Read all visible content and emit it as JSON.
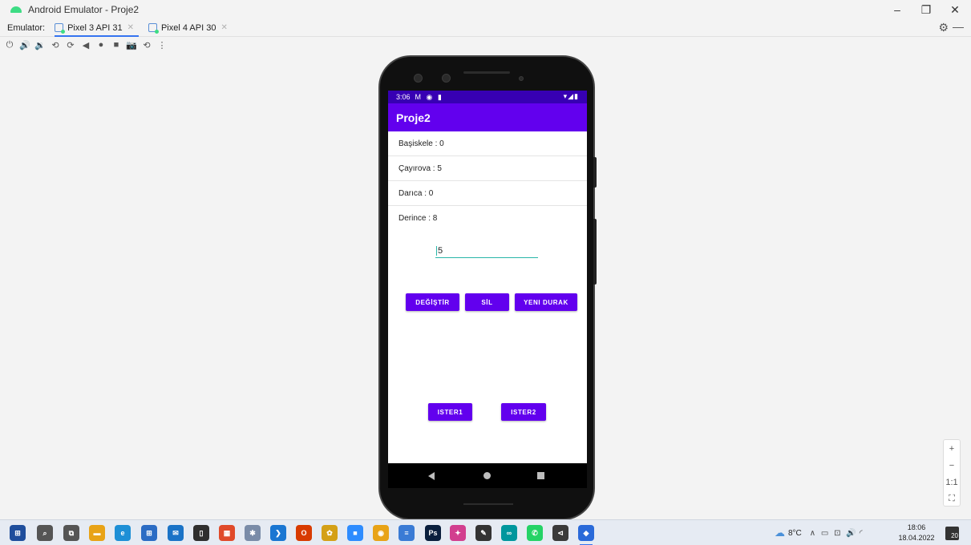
{
  "window": {
    "title": "Android Emulator - Proje2",
    "minimize": "–",
    "maximize": "❐",
    "close": "✕"
  },
  "tabs": {
    "label": "Emulator:",
    "items": [
      {
        "label": "Pixel 3 API 31",
        "active": true
      },
      {
        "label": "Pixel 4 API 30",
        "active": false
      }
    ],
    "close_glyph": "✕",
    "settings_glyph": "⚙",
    "minimize_glyph": "—"
  },
  "toolbar": {
    "icons": [
      "power-icon",
      "volume-up-icon",
      "volume-down-icon",
      "rotate-left-icon",
      "rotate-right-icon",
      "back-icon",
      "home-icon",
      "overview-icon",
      "screenshot-icon",
      "snapshot-icon",
      "more-icon"
    ],
    "glyphs": [
      "⏻",
      "🔊",
      "🔉",
      "⟲",
      "⟳",
      "◀",
      "●",
      "■",
      "📷",
      "⟲",
      "⋮"
    ]
  },
  "device": {
    "status_time": "3:06",
    "status_icons": "M ◉ ▮",
    "status_right": "▾◢▮",
    "app_title": "Proje2",
    "list": [
      "Başiskele : 0",
      "Çayırova : 5",
      "Darıca : 0",
      "Derince : 8"
    ],
    "edit_value": "5",
    "buttons": {
      "degistir": "DEĞİŞTİR",
      "sil": "SİL",
      "yeni_durak": "YENI DURAK",
      "ister1": "ISTER1",
      "ister2": "ISTER2"
    }
  },
  "zoom": {
    "zoom_in": "+",
    "zoom_out": "−",
    "actual": "1:1",
    "fit": "⛶"
  },
  "taskbar": {
    "weather": "8°C",
    "tray_glyphs": "∧ ▭ ⊡ 🔊 ",
    "time": "18:06",
    "date": "18.04.2022",
    "notifications": "20",
    "apps": [
      {
        "name": "start-icon",
        "glyph": "⊞",
        "color": "#1f4e9c"
      },
      {
        "name": "search-icon",
        "glyph": "⌕",
        "color": "#555555"
      },
      {
        "name": "task-view-icon",
        "glyph": "⧉",
        "color": "#555555"
      },
      {
        "name": "file-explorer-icon",
        "glyph": "▬",
        "color": "#e8a317"
      },
      {
        "name": "edge-icon",
        "glyph": "e",
        "color": "#1d8fd6"
      },
      {
        "name": "store-icon",
        "glyph": "⊞",
        "color": "#2b6cc4"
      },
      {
        "name": "mail-icon",
        "glyph": "✉",
        "color": "#1a73c7"
      },
      {
        "name": "notepad-icon",
        "glyph": "▯",
        "color": "#2f2f2f"
      },
      {
        "name": "ms-apps-icon",
        "glyph": "▦",
        "color": "#e04a2a"
      },
      {
        "name": "unity-icon",
        "glyph": "✱",
        "color": "#7a8ca8"
      },
      {
        "name": "vscode-icon",
        "glyph": "❯",
        "color": "#1976d2"
      },
      {
        "name": "office-icon",
        "glyph": "O",
        "color": "#d83b01"
      },
      {
        "name": "paint-icon",
        "glyph": "✿",
        "color": "#d4a017"
      },
      {
        "name": "zoom-icon",
        "glyph": "■",
        "color": "#2d8cff"
      },
      {
        "name": "chrome-icon",
        "glyph": "◉",
        "color": "#e8a317"
      },
      {
        "name": "sublime-icon",
        "glyph": "≡",
        "color": "#3a7bd5"
      },
      {
        "name": "photoshop-icon",
        "glyph": "Ps",
        "color": "#0a1f3d"
      },
      {
        "name": "brain-app-icon",
        "glyph": "✦",
        "color": "#d23f8f"
      },
      {
        "name": "pen-tool-icon",
        "glyph": "✎",
        "color": "#333333"
      },
      {
        "name": "arduino-icon",
        "glyph": "∞",
        "color": "#00979d"
      },
      {
        "name": "whatsapp-icon",
        "glyph": "✆",
        "color": "#25d366"
      },
      {
        "name": "android-studio-tool-icon",
        "glyph": "⊲",
        "color": "#3a3a3a"
      },
      {
        "name": "android-studio-icon",
        "glyph": "◆",
        "color": "#2a6ad9"
      }
    ]
  },
  "colors": {
    "primary": "#6200ee",
    "primary_dark": "#3700b3",
    "accent": "#29b6a8"
  }
}
